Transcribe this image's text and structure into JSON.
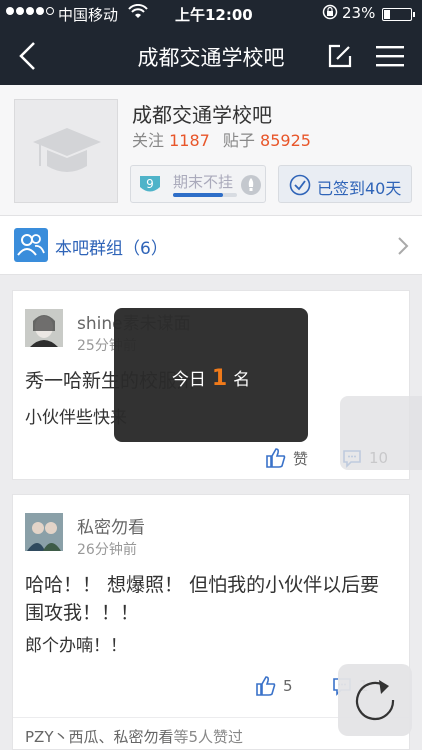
{
  "status_bar": {
    "carrier": "中国移动",
    "time": "上午12:00",
    "battery_percent": "23%",
    "battery_level": 0.23,
    "signal_bars": 4
  },
  "nav": {
    "title": "成都交通学校吧",
    "icons": [
      "back-icon",
      "edit-icon",
      "menu-icon"
    ]
  },
  "forum": {
    "name": "成都交通学校吧",
    "follow_label": "关注",
    "follow_count": "1187",
    "posts_label": "贴子",
    "posts_count": "85925",
    "level_number": "9",
    "level_name": "期末不挂",
    "level_progress": 0.78,
    "signed_label": "已签到40天"
  },
  "groups": {
    "label": "本吧群组（6）"
  },
  "posts": [
    {
      "user": "shine素未谋面",
      "time": "25分钟前",
      "title": "秀一哈新生的校服卅",
      "body": "小伙伴些快来",
      "like_label": "赞",
      "comment_count": "10"
    },
    {
      "user": "私密勿看",
      "time": "26分钟前",
      "title": "哈哈！！ 想爆照！ 但怕我的小伙伴以后要围攻我！！！",
      "body": "郎个办喃！！",
      "like_count": "5",
      "comment_count": "1",
      "likers_names": "PZY丶西瓜、私密勿看",
      "likers_suffix": "等5人赞过"
    }
  ],
  "toast": {
    "prefix": "今日",
    "rank": "1",
    "suffix": "名"
  },
  "colors": {
    "nav_bg": "#1f2630",
    "accent_blue": "#2f64b8",
    "count_orange": "#e8562a",
    "rank_orange": "#f07a1a"
  }
}
